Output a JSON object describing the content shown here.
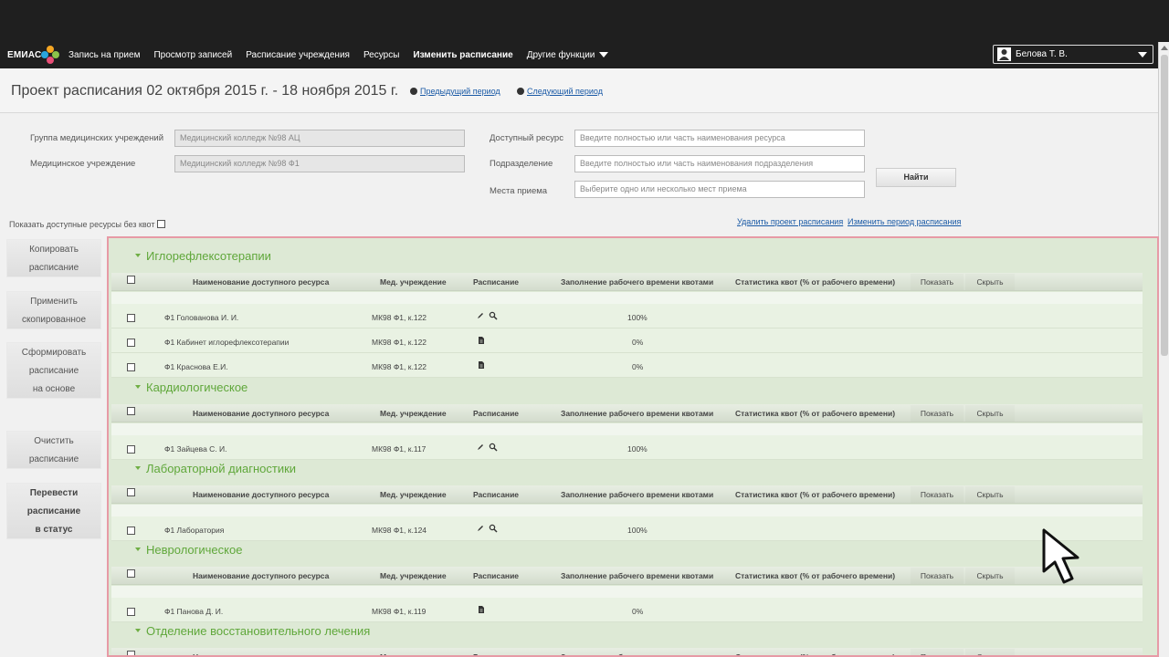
{
  "nav": {
    "logo": "ЕМИАС",
    "items": [
      {
        "label": "Запись на прием",
        "active": false
      },
      {
        "label": "Просмотр записей",
        "active": false
      },
      {
        "label": "Расписание учреждения",
        "active": false
      },
      {
        "label": "Ресурсы",
        "active": false
      },
      {
        "label": "Изменить расписание",
        "active": true
      },
      {
        "label": "Другие функции",
        "active": false
      }
    ],
    "user": "Белова Т. В."
  },
  "header": {
    "title": "Проект расписания 02 октября 2015 г. - 18 ноября 2015 г.",
    "prev_period": "Предыдущий период",
    "next_period": "Следующий период"
  },
  "filters": {
    "group_label": "Группа медицинских учреждений",
    "group_value": "Медицинский колледж №98 АЦ",
    "institution_label": "Медицинское учреждение",
    "institution_value": "Медицинский колледж №98 Ф1",
    "resource_label": "Доступный ресурс",
    "resource_placeholder": "Введите полностью или часть наименования ресурса",
    "department_label": "Подразделение",
    "department_placeholder": "Введите полностью или часть наименования подразделения",
    "place_label": "Места приема",
    "place_placeholder": "Выберите одно или несколько мест приема",
    "find_button": "Найти",
    "show_free": "Показать доступные ресурсы без квот",
    "delete_project": "Удалить проект расписания",
    "change_period": "Изменить период расписания"
  },
  "sidebar": {
    "copy": [
      "Копировать",
      "расписание"
    ],
    "apply": [
      "Применить",
      "скопированное"
    ],
    "form": [
      "Сформировать",
      "расписание",
      "на основе"
    ],
    "clear": [
      "Очистить",
      "расписание"
    ],
    "status": [
      "Перевести",
      "расписание",
      "в статус"
    ]
  },
  "columns": {
    "name": "Наименование доступного ресурса",
    "institution": "Мед. учреждение",
    "schedule": "Расписание",
    "fill": "Заполнение рабочего времени квотами",
    "stats": "Статистика квот (% от рабочего времени)",
    "show": "Показать",
    "hide": "Скрыть"
  },
  "groups": [
    {
      "title": "Иглорефлексотерапии",
      "rows": [
        {
          "name": "Ф1 Голованова И. И.",
          "inst": "МК98 Ф1, к.122",
          "icon": "edit-search",
          "fill": "100%"
        },
        {
          "name": "Ф1 Кабинет иглорефлексотерапии",
          "inst": "МК98 Ф1, к.122",
          "icon": "document",
          "fill": "0%"
        },
        {
          "name": "Ф1 Краснова Е.И.",
          "inst": "МК98 Ф1, к.122",
          "icon": "document",
          "fill": "0%"
        }
      ]
    },
    {
      "title": "Кардиологическое",
      "rows": [
        {
          "name": "Ф1 Зайцева С. И.",
          "inst": "МК98 Ф1, к.117",
          "icon": "edit-search",
          "fill": "100%"
        }
      ]
    },
    {
      "title": "Лабораторной диагностики",
      "rows": [
        {
          "name": "Ф1 Лаборатория",
          "inst": "МК98 Ф1, к.124",
          "icon": "edit-search",
          "fill": "100%"
        }
      ]
    },
    {
      "title": "Неврологическое",
      "rows": [
        {
          "name": "Ф1 Панова Д. И.",
          "inst": "МК98 Ф1, к.119",
          "icon": "document",
          "fill": "0%"
        }
      ]
    },
    {
      "title": "Отделение восстановительного лечения",
      "rows": []
    }
  ],
  "colors": {
    "nav_bg": "#1f1f1f",
    "group_title": "#5fa73a",
    "panel_border": "#e79aa6",
    "panel_bg": "#dde9d5",
    "link": "#1a5aa6"
  }
}
